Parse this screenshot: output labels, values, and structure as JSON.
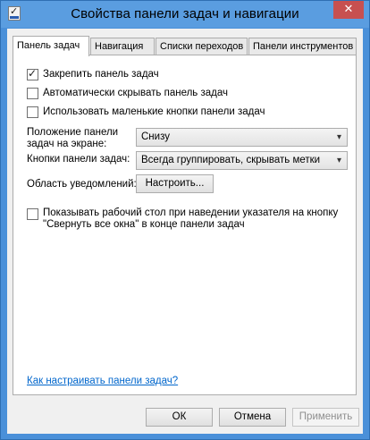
{
  "window": {
    "title": "Свойства панели задач и навигации",
    "close_glyph": "✕"
  },
  "tabs": [
    {
      "label": "Панель задач",
      "active": true
    },
    {
      "label": "Навигация",
      "active": false
    },
    {
      "label": "Списки переходов",
      "active": false
    },
    {
      "label": "Панели инструментов",
      "active": false
    }
  ],
  "options": {
    "lock_taskbar": {
      "label": "Закрепить панель задач",
      "checked": true
    },
    "autohide": {
      "label": "Автоматически скрывать панель задач",
      "checked": false
    },
    "small_buttons": {
      "label": "Использовать маленькие кнопки панели задач",
      "checked": false
    },
    "position_label": "Положение панели задач на экране:",
    "position_value": "Снизу",
    "buttons_label": "Кнопки панели задач:",
    "buttons_value": "Всегда группировать, скрывать метки",
    "notif_label": "Область уведомлений:",
    "notif_button": "Настроить...",
    "peek": {
      "label": "Показывать рабочий стол при наведении указателя на кнопку \"Свернуть все окна\" в конце панели задач",
      "checked": false
    }
  },
  "help_link": "Как настраивать панели задач?",
  "footer": {
    "ok": "ОК",
    "cancel": "Отмена",
    "apply": "Применить"
  },
  "icons": {
    "app": "taskbar-properties-icon",
    "close": "close-icon",
    "dropdown": "chevron-down-icon"
  }
}
